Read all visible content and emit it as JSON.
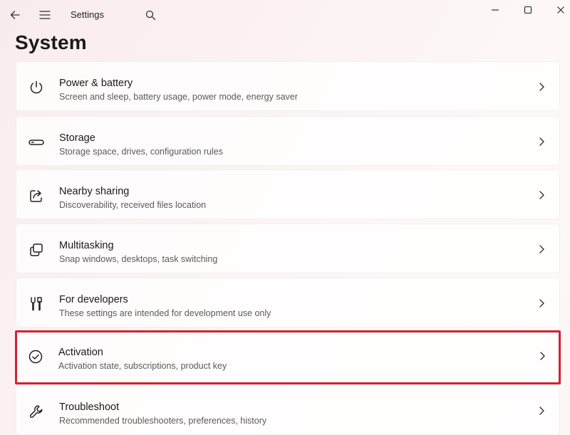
{
  "titlebar": {
    "app_title": "Settings",
    "back_icon": "arrow-left-icon",
    "menu_icon": "hamburger-menu-icon",
    "search_icon": "search-icon",
    "window_controls": [
      "minimize-icon",
      "maximize-icon",
      "close-icon"
    ]
  },
  "page": {
    "title": "System"
  },
  "settings_items": [
    {
      "title": "Power & battery",
      "subtitle": "Screen and sleep, battery usage, power mode, energy saver",
      "icon": "power-icon"
    },
    {
      "title": "Storage",
      "subtitle": "Storage space, drives, configuration rules",
      "icon": "storage-drive-icon"
    },
    {
      "title": "Nearby sharing",
      "subtitle": "Discoverability, received files location",
      "icon": "share-icon"
    },
    {
      "title": "Multitasking",
      "subtitle": "Snap windows, desktops, task switching",
      "icon": "multitasking-windows-icon"
    },
    {
      "title": "For developers",
      "subtitle": "These settings are intended for development use only",
      "icon": "developer-tools-icon"
    },
    {
      "title": "Activation",
      "subtitle": "Activation state, subscriptions, product key",
      "icon": "check-circle-icon",
      "highlighted": true
    },
    {
      "title": "Troubleshoot",
      "subtitle": "Recommended troubleshooters, preferences, history",
      "icon": "wrench-icon"
    }
  ],
  "colors": {
    "highlight_border": "#cf2230",
    "background": "#fbf2f1",
    "card": "#ffffff"
  }
}
